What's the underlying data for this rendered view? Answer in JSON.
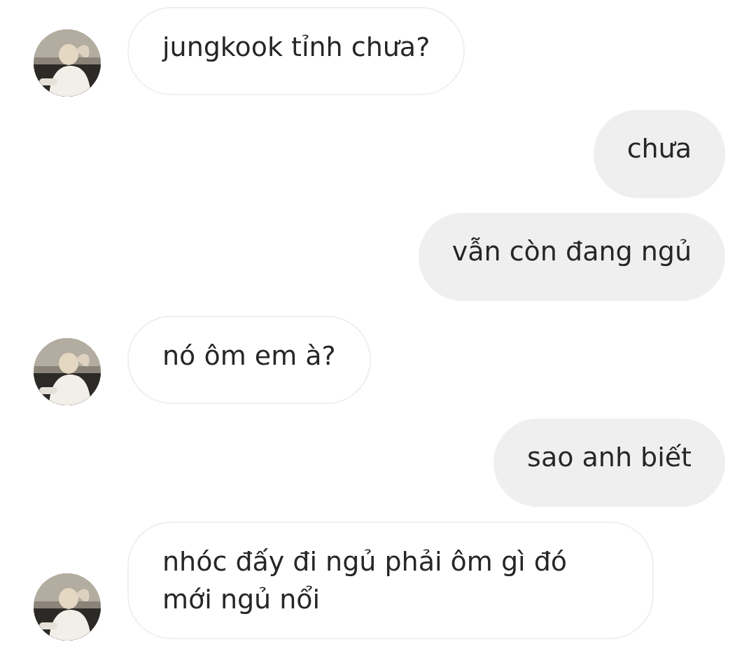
{
  "messages": [
    {
      "kind": "incoming",
      "text": "jungkook tỉnh chưa?"
    },
    {
      "kind": "outgoing",
      "text": "chưa"
    },
    {
      "kind": "outgoing",
      "text": "vẫn còn đang ngủ"
    },
    {
      "kind": "incoming",
      "text": "nó ôm em à?"
    },
    {
      "kind": "outgoing",
      "text": "sao anh biết"
    },
    {
      "kind": "incoming",
      "text": "nhóc đấy đi ngủ phải ôm gì đó mới ngủ nổi"
    }
  ]
}
